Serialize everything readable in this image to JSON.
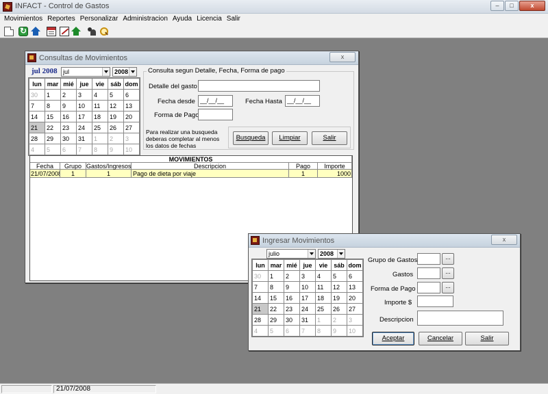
{
  "app": {
    "title": "INFACT - Control de Gastos",
    "close": "x",
    "minimize": "–",
    "maximize": "□"
  },
  "menu": [
    "Movimientos",
    "Reportes",
    "Personalizar",
    "Administracion",
    "Ayuda",
    "Licencia",
    "Salir"
  ],
  "status": {
    "date": "21/07/2008"
  },
  "consultas": {
    "title": "Consultas de Movimientos",
    "close": "x",
    "cal_month_label": "jul 2008",
    "month_select": "jul",
    "year_select": "2008",
    "days_header": [
      "lun",
      "mar",
      "mié",
      "jue",
      "vie",
      "sáb",
      "dom"
    ],
    "group_title": "Consulta segun Detalle, Fecha, Forma de pago",
    "detalle_label": "Detalle del gasto",
    "fecha_desde_label": "Fecha desde",
    "fecha_desde_value": "__/__/__",
    "fecha_hasta_label": "Fecha Hasta",
    "fecha_hasta_value": "__/__/__",
    "forma_pago_label": "Forma de Pago",
    "hint": [
      "Para realizar una busqueda",
      "deberas completar al menos",
      "los datos de fechas"
    ],
    "btn_busqueda": "Busqueda",
    "btn_limpiar": "Limpiar",
    "btn_salir": "Salir",
    "grid_title": "MOVIMIENTOS",
    "columns": [
      "Fecha",
      "Grupo",
      "Gastos/Ingresos",
      "Descripcion",
      "Pago",
      "Importe"
    ],
    "row": {
      "fecha": "21/07/2008",
      "grupo": "1",
      "gastos": "1",
      "descripcion": "Pago de dieta por viaje",
      "pago": "1",
      "importe": "1000"
    }
  },
  "ingresar": {
    "title": "Ingresar Movimientos",
    "close": "x",
    "month_select": "julio",
    "year_select": "2008",
    "days_header": [
      "lun",
      "mar",
      "mié",
      "jue",
      "vie",
      "sáb",
      "dom"
    ],
    "grupo_label": "Grupo de Gastos",
    "gastos_label": "Gastos",
    "forma_pago_label": "Forma de Pago",
    "importe_label": "Importe $",
    "descripcion_label": "Descripcion",
    "ellipsis": "...",
    "btn_aceptar": "Aceptar",
    "btn_cancelar": "Cancelar",
    "btn_salir": "Salir"
  },
  "calendar": {
    "weeks": [
      [
        "30",
        "1",
        "2",
        "3",
        "4",
        "5",
        "6"
      ],
      [
        "7",
        "8",
        "9",
        "10",
        "11",
        "12",
        "13"
      ],
      [
        "14",
        "15",
        "16",
        "17",
        "18",
        "19",
        "20"
      ],
      [
        "21",
        "22",
        "23",
        "24",
        "25",
        "26",
        "27"
      ],
      [
        "28",
        "29",
        "30",
        "31",
        "1",
        "2",
        "3"
      ],
      [
        "4",
        "5",
        "6",
        "7",
        "8",
        "9",
        "10"
      ]
    ],
    "selected": "21"
  }
}
